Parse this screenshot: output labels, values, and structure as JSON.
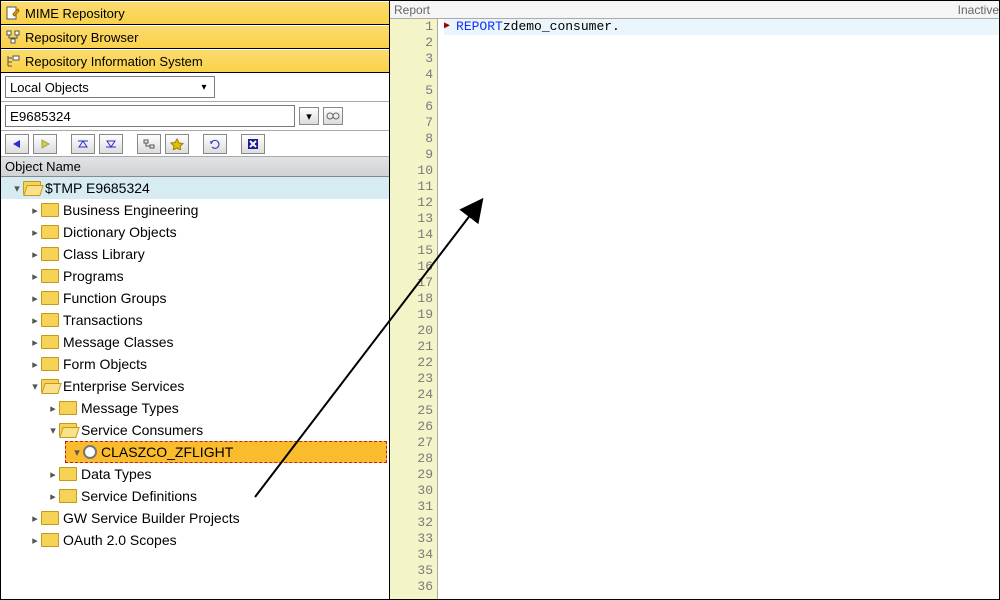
{
  "panels": {
    "mime": "MIME Repository",
    "browser": "Repository Browser",
    "ris": "Repository Information System"
  },
  "selector": {
    "scope": "Local Objects",
    "object": "E9685324"
  },
  "tree": {
    "header": "Object Name",
    "root": "$TMP E9685324",
    "n": {
      "be": "Business Engineering",
      "dict": "Dictionary Objects",
      "cl": "Class Library",
      "prog": "Programs",
      "fg": "Function Groups",
      "tx": "Transactions",
      "mc": "Message Classes",
      "fo": "Form Objects",
      "es": "Enterprise Services",
      "mt": "Message Types",
      "sc": "Service Consumers",
      "clas": "CLASZCO_ZFLIGHT",
      "dt": "Data Types",
      "sd": "Service Definitions",
      "gw": "GW Service Builder Projects",
      "oa": "OAuth 2.0 Scopes"
    }
  },
  "editor": {
    "tab_label": "Report",
    "status": "Inactive",
    "line1": "REPORT",
    "line1b": " zdemo_consumer.",
    "line_start": 1,
    "line_end": 36
  }
}
